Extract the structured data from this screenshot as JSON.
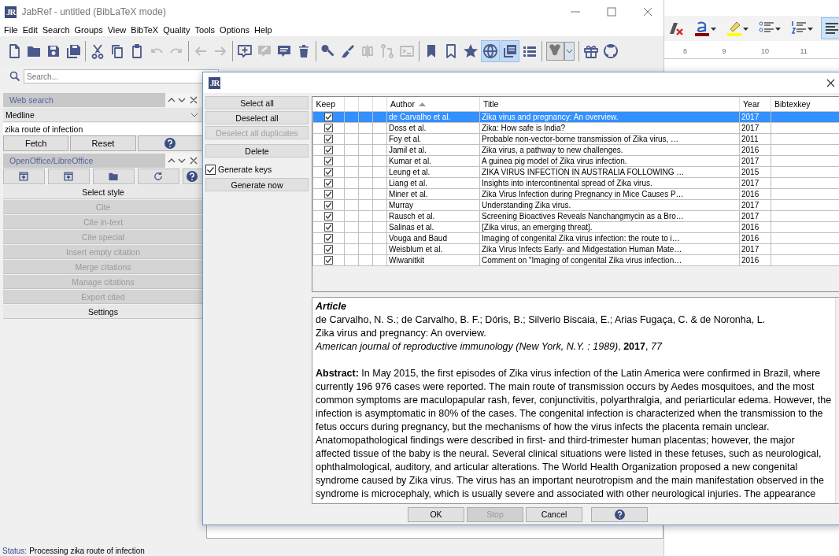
{
  "main_window": {
    "logo": "JR",
    "title": "JabRef - untitled (BibLaTeX mode)",
    "menu": [
      "File",
      "Edit",
      "Search",
      "Groups",
      "View",
      "BibTeX",
      "Quality",
      "Tools",
      "Options",
      "Help"
    ],
    "toolbar": [
      {
        "kind": "new",
        "disabled": false,
        "selected": false
      },
      {
        "kind": "open",
        "disabled": false,
        "selected": false
      },
      {
        "kind": "save",
        "disabled": false,
        "selected": false
      },
      {
        "kind": "saveall",
        "disabled": false,
        "selected": false
      },
      {
        "kind": "sep"
      },
      {
        "kind": "cut",
        "disabled": false,
        "selected": false
      },
      {
        "kind": "copy",
        "disabled": false,
        "selected": false
      },
      {
        "kind": "paste",
        "disabled": false,
        "selected": false
      },
      {
        "kind": "undo",
        "disabled": true,
        "selected": false
      },
      {
        "kind": "redo",
        "disabled": true,
        "selected": false
      },
      {
        "kind": "sep"
      },
      {
        "kind": "back",
        "disabled": true,
        "selected": false
      },
      {
        "kind": "forward",
        "disabled": true,
        "selected": false
      },
      {
        "kind": "sep"
      },
      {
        "kind": "newentry",
        "disabled": false,
        "selected": false
      },
      {
        "kind": "edit",
        "disabled": true,
        "selected": false
      },
      {
        "kind": "comment",
        "disabled": false,
        "selected": false
      },
      {
        "kind": "trash",
        "disabled": false,
        "selected": false
      },
      {
        "kind": "sep"
      },
      {
        "kind": "key",
        "disabled": false,
        "selected": false
      },
      {
        "kind": "broom",
        "disabled": false,
        "selected": false
      },
      {
        "kind": "split",
        "disabled": true,
        "selected": false
      },
      {
        "kind": "merge",
        "disabled": true,
        "selected": false
      },
      {
        "kind": "terminal",
        "disabled": true,
        "selected": false
      },
      {
        "kind": "sep"
      },
      {
        "kind": "bookmark",
        "disabled": false,
        "selected": false
      },
      {
        "kind": "bookmarkoutline",
        "disabled": false,
        "selected": false
      },
      {
        "kind": "star",
        "disabled": false,
        "selected": false
      },
      {
        "kind": "globe",
        "disabled": false,
        "selected": true
      },
      {
        "kind": "preview",
        "disabled": false,
        "selected": true
      },
      {
        "kind": "list",
        "disabled": false,
        "selected": false
      },
      {
        "kind": "sep"
      },
      {
        "kind": "gnu"
      },
      {
        "kind": "sep"
      },
      {
        "kind": "gift",
        "disabled": false,
        "selected": false
      },
      {
        "kind": "github",
        "disabled": false,
        "selected": false
      }
    ],
    "search": {
      "placeholder": "Search..."
    },
    "web_search": {
      "title": "Web search",
      "fetcher": "Medline",
      "query": "zika route of infection",
      "buttons": [
        "Fetch",
        "Reset"
      ]
    },
    "office": {
      "title": "OpenOffice/LibreOffice",
      "icon_buttons": [
        {
          "kind": "panel"
        },
        {
          "kind": "panel"
        },
        {
          "kind": "folder"
        },
        {
          "kind": "refresh"
        },
        {
          "kind": "help"
        }
      ],
      "actions": [
        {
          "label": "Select style",
          "disabled": false
        },
        {
          "label": "Cite",
          "disabled": true
        },
        {
          "label": "Cite in-text",
          "disabled": true
        },
        {
          "label": "Cite special",
          "disabled": true
        },
        {
          "label": "Insert empty citation",
          "disabled": true
        },
        {
          "label": "Merge citations",
          "disabled": true
        },
        {
          "label": "Manage citations",
          "disabled": true
        },
        {
          "label": "Export cited",
          "disabled": true
        },
        {
          "label": "Settings",
          "disabled": false
        }
      ]
    },
    "status_bar": {
      "label": "Status:",
      "text": "Processing zika route of infection"
    }
  },
  "background_window": {
    "toolbar": [
      {
        "kind": "clearformat",
        "dropdown": false,
        "selected": false
      },
      {
        "kind": "fontcolor",
        "dropdown": true,
        "selected": false
      },
      {
        "kind": "highlight",
        "dropdown": true,
        "selected": false
      },
      {
        "kind": "bullets",
        "dropdown": true,
        "selected": false
      },
      {
        "kind": "numbering",
        "dropdown": true,
        "selected": false
      },
      {
        "kind": "align",
        "dropdown": false,
        "selected": true
      }
    ],
    "ruler_numbers": [
      "8",
      "9",
      "10",
      "11"
    ]
  },
  "dialog": {
    "logo": "JR",
    "buttons": [
      {
        "label": "Select all",
        "disabled": false
      },
      {
        "label": "Deselect all",
        "disabled": false
      },
      {
        "label": "Deselect all duplicates",
        "disabled": true
      },
      {
        "label": "Delete",
        "disabled": false
      }
    ],
    "generate_keys": {
      "label": "Generate keys",
      "checked": true
    },
    "generate_button": "Generate now",
    "table": {
      "columns": [
        {
          "label": "Keep",
          "sorted": false
        },
        {
          "label": "Author",
          "sorted": true
        },
        {
          "label": "Title",
          "sorted": false
        },
        {
          "label": "Year",
          "sorted": false
        },
        {
          "label": "Bibtexkey",
          "sorted": false
        }
      ],
      "rows": [
        {
          "keep": true,
          "author": "de Carvalho et al.",
          "title": "Zika virus and pregnancy: An overview.",
          "year": "2017",
          "selected": true
        },
        {
          "keep": true,
          "author": "Doss et al.",
          "title": "Zika: How safe is India?",
          "year": "2017",
          "selected": false
        },
        {
          "keep": true,
          "author": "Foy et al.",
          "title": "Probable non-vector-borne transmission of Zika virus, …",
          "year": "2011",
          "selected": false
        },
        {
          "keep": true,
          "author": "Jamil et al.",
          "title": "Zika virus, a pathway to new challenges.",
          "year": "2016",
          "selected": false
        },
        {
          "keep": true,
          "author": "Kumar et al.",
          "title": "A guinea pig model of Zika virus infection.",
          "year": "2017",
          "selected": false
        },
        {
          "keep": true,
          "author": "Leung et al.",
          "title": "ZIKA VIRUS INFECTION IN AUSTRALIA FOLLOWING …",
          "year": "2015",
          "selected": false
        },
        {
          "keep": true,
          "author": "Liang et al.",
          "title": "Insights into intercontinental spread of Zika virus.",
          "year": "2017",
          "selected": false
        },
        {
          "keep": true,
          "author": "Miner et al.",
          "title": "Zika Virus Infection during Pregnancy in Mice Causes P…",
          "year": "2016",
          "selected": false
        },
        {
          "keep": true,
          "author": "Murray",
          "title": "Understanding Zika virus.",
          "year": "2017",
          "selected": false
        },
        {
          "keep": true,
          "author": "Rausch et al.",
          "title": "Screening Bioactives Reveals Nanchangmycin as a Bro…",
          "year": "2017",
          "selected": false
        },
        {
          "keep": true,
          "author": "Salinas et al.",
          "title": "[Zika virus, an emerging threat].",
          "year": "2016",
          "selected": false
        },
        {
          "keep": true,
          "author": "Vouga and Baud",
          "title": "Imaging of congenital Zika virus infection: the route to i…",
          "year": "2016",
          "selected": false
        },
        {
          "keep": true,
          "author": "Weisblum et al.",
          "title": "Zika Virus Infects Early- and Midgestation Human Mate…",
          "year": "2017",
          "selected": false
        },
        {
          "keep": true,
          "author": "Wiwanitkit",
          "title": "Comment on \"Imaging of congenital Zika virus infection…",
          "year": "2016",
          "selected": false
        }
      ]
    },
    "preview": {
      "type": "Article",
      "authors": "de Carvalho, N. S.; de Carvalho, B. F.; Dóris, B.; Silverio Biscaia, E.; Arias Fugaça, C. & de Noronha, L.",
      "title": "Zika virus and pregnancy: An overview.",
      "journal": "*American journal of reproductive immunology (New York, N.Y. : 1989)*, **2017**, *77*",
      "abstract": "**Abstract:** In May 2015, the first episodes of Zika virus infection of the Latin America were confirmed in Brazil, where currently 196 976 cases were reported. The main route of transmission occurs by Aedes mosquitoes, and the most common symptoms are maculopapular rash, fever, conjunctivitis, polyarthralgia, and periarticular edema. However, the infection is asymptomatic in 80% of the cases. The congenital infection is characterized when the transmission to the fetus occurs during pregnancy, but the mechanisms of how the virus infects the placenta remain unclear. Anatomopathological findings were described in first- and third-trimester human placentas; however, the major affected tissue of the baby is the neural. Several clinical situations were listed in these fetuses, such as neurological, ophthalmological, auditory, and articular alterations. The World Health Organization proposed a new congenital syndrome caused by Zika virus. The virus has an important neurotropism and the main manifestation observed in the syndrome is microcephaly, which is usually severe and associated with other neurological injuries. The appearance"
    },
    "footer_buttons": [
      {
        "kind": "text",
        "label": "OK",
        "disabled": false
      },
      {
        "kind": "text",
        "label": "Stop",
        "disabled": true
      },
      {
        "kind": "text",
        "label": "Cancel",
        "disabled": false
      },
      {
        "kind": "help",
        "disabled": false
      }
    ]
  }
}
